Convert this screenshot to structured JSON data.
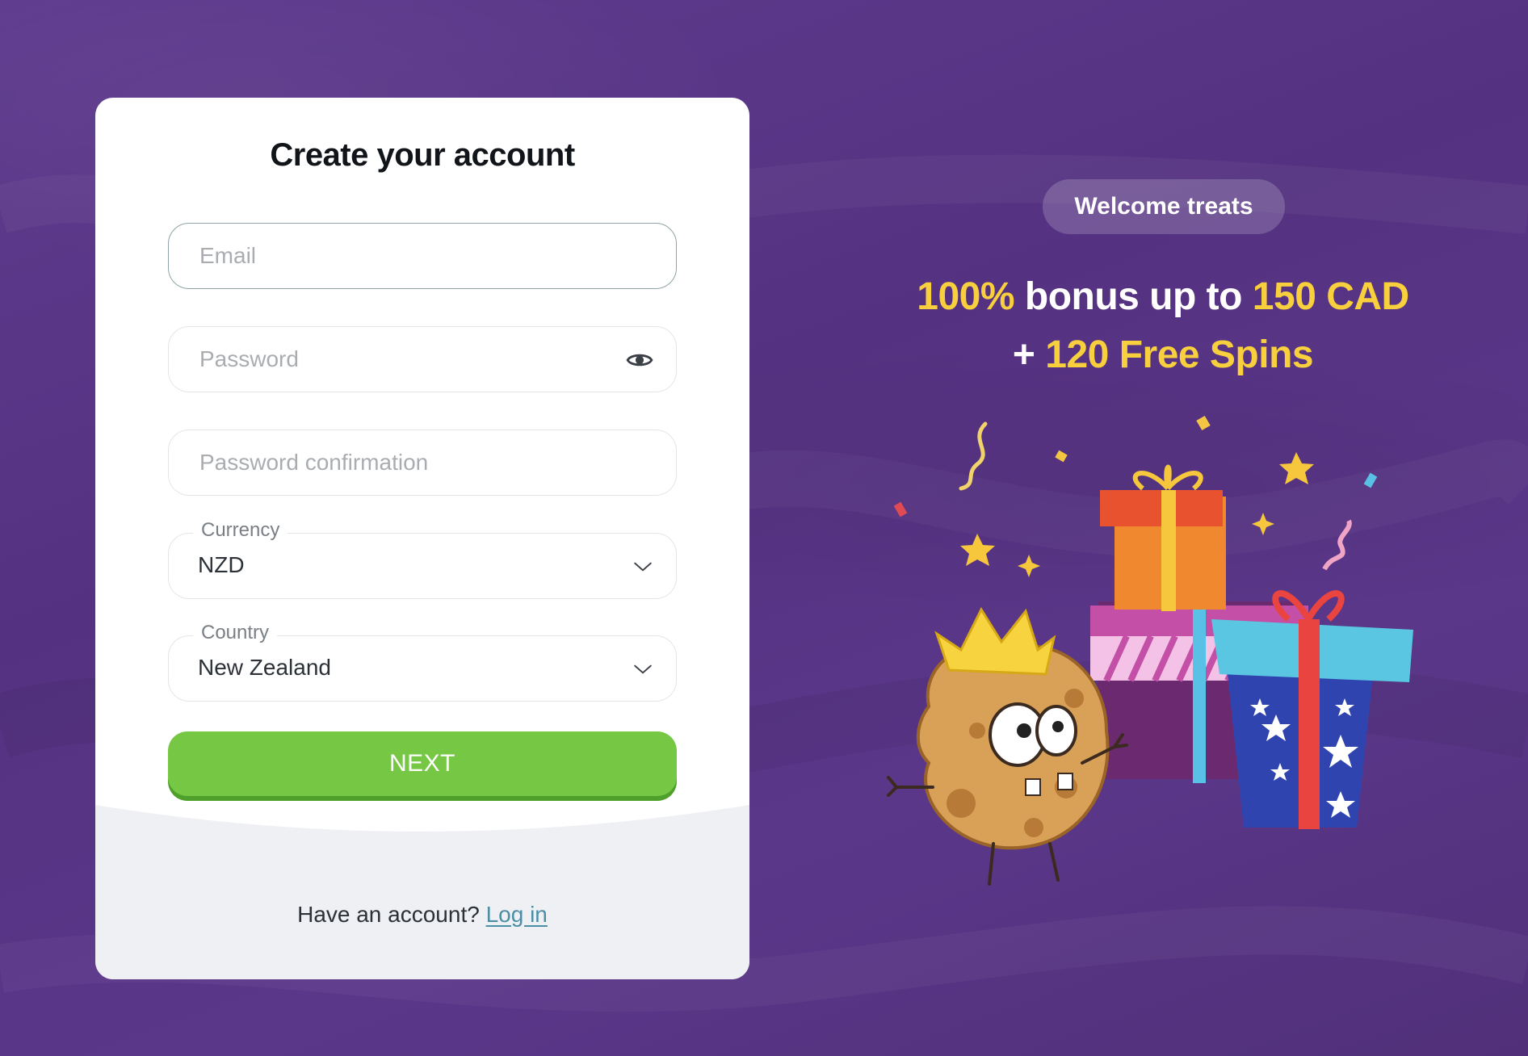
{
  "form": {
    "title": "Create your account",
    "email_placeholder": "Email",
    "password_placeholder": "Password",
    "password_confirm_placeholder": "Password confirmation",
    "currency": {
      "label": "Currency",
      "value": "NZD"
    },
    "country": {
      "label": "Country",
      "value": "New Zealand"
    },
    "next_label": "NEXT",
    "footer_prompt": "Have an account?",
    "login_label": "Log in"
  },
  "promo": {
    "badge": "Welcome treats",
    "line1_a": "100%",
    "line1_b": " bonus up to ",
    "line1_c": "150 CAD",
    "line2_a": "+ ",
    "line2_b": "120 Free Spins"
  },
  "colors": {
    "background": "#5a3788",
    "accent_green": "#76c844",
    "accent_yellow": "#f8cf3d",
    "link": "#4b8ea6"
  },
  "icons": {
    "password_toggle": "eye-icon",
    "select": "chevron-down-icon"
  }
}
